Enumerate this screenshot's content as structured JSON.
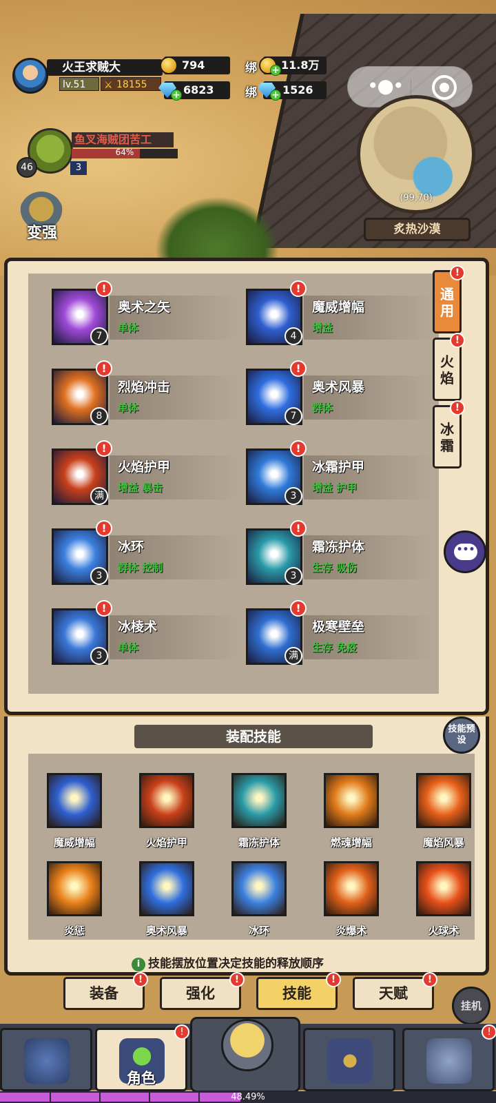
{
  "player": {
    "name": "火王求贼大",
    "level": "lv.51",
    "power": "18155"
  },
  "currency": {
    "gold": "794",
    "gems": "6823",
    "bind_label": "绑",
    "bound_gold": "11.8万",
    "bound_gems": "1526"
  },
  "quest": {
    "title": "鱼叉海贼团苦工",
    "progress_text": "64%",
    "progress": 0.64,
    "level": "46",
    "count": "3"
  },
  "boost_label": "变强",
  "map": {
    "coord": "(99,70)",
    "name": "炙热沙漠"
  },
  "alert_mark": "!",
  "skills": [
    {
      "name": "奥术之矢",
      "tags": "单体",
      "level": "7",
      "color": "#a04ad8"
    },
    {
      "name": "魔威增幅",
      "tags": "增益",
      "level": "4",
      "color": "#2f5fd0"
    },
    {
      "name": "烈焰冲击",
      "tags": "单体",
      "level": "8",
      "color": "#e07020"
    },
    {
      "name": "奥术风暴",
      "tags": "群体",
      "level": "7",
      "color": "#2f6ee0"
    },
    {
      "name": "火焰护甲",
      "tags": "增益 暴击",
      "level": "满",
      "color": "#c8401a"
    },
    {
      "name": "冰霜护甲",
      "tags": "增益 护甲",
      "level": "3",
      "color": "#2f7ad8"
    },
    {
      "name": "冰环",
      "tags": "群体 控制",
      "level": "3",
      "color": "#3c80e0"
    },
    {
      "name": "霜冻护体",
      "tags": "生存 吸伤",
      "level": "3",
      "color": "#2a9aa8"
    },
    {
      "name": "冰棱术",
      "tags": "单体",
      "level": "3",
      "color": "#3a78d8"
    },
    {
      "name": "极寒壁垒",
      "tags": "生存 免疫",
      "level": "满",
      "color": "#2f6ed0"
    }
  ],
  "tabs": [
    {
      "label": "通用"
    },
    {
      "label": "火焰"
    },
    {
      "label": "冰霜"
    }
  ],
  "equip": {
    "title": "装配技能",
    "preset": "技能预设",
    "slots": [
      {
        "name": "魔威增幅",
        "color": "#2f5fd0"
      },
      {
        "name": "火焰护甲",
        "color": "#c8401a"
      },
      {
        "name": "霜冻护体",
        "color": "#2a9aa8"
      },
      {
        "name": "燃魂增幅",
        "color": "#e07a1a"
      },
      {
        "name": "魔焰风暴",
        "color": "#e8601a"
      },
      {
        "name": "炎惩",
        "color": "#e8801a"
      },
      {
        "name": "奥术风暴",
        "color": "#2f6ee0"
      },
      {
        "name": "冰环",
        "color": "#3c80e0"
      },
      {
        "name": "炎爆术",
        "color": "#e0601a"
      },
      {
        "name": "火球术",
        "color": "#e8501a"
      }
    ],
    "hint": "技能摆放位置决定技能的释放顺序"
  },
  "subtabs": [
    {
      "label": "装备"
    },
    {
      "label": "强化"
    },
    {
      "label": "技能"
    },
    {
      "label": "天赋"
    }
  ],
  "idle_label": "挂机",
  "nav": {
    "role_label": "角色"
  },
  "exp": {
    "text": "48.49%",
    "value": 0.4849
  },
  "colors": {
    "panel_bg": "#f2e3c7",
    "accent_orange": "#e98a3a",
    "tag_green": "#3ec43a",
    "alert_red": "#e23a2e",
    "exp_purple": "#c85bd8"
  }
}
